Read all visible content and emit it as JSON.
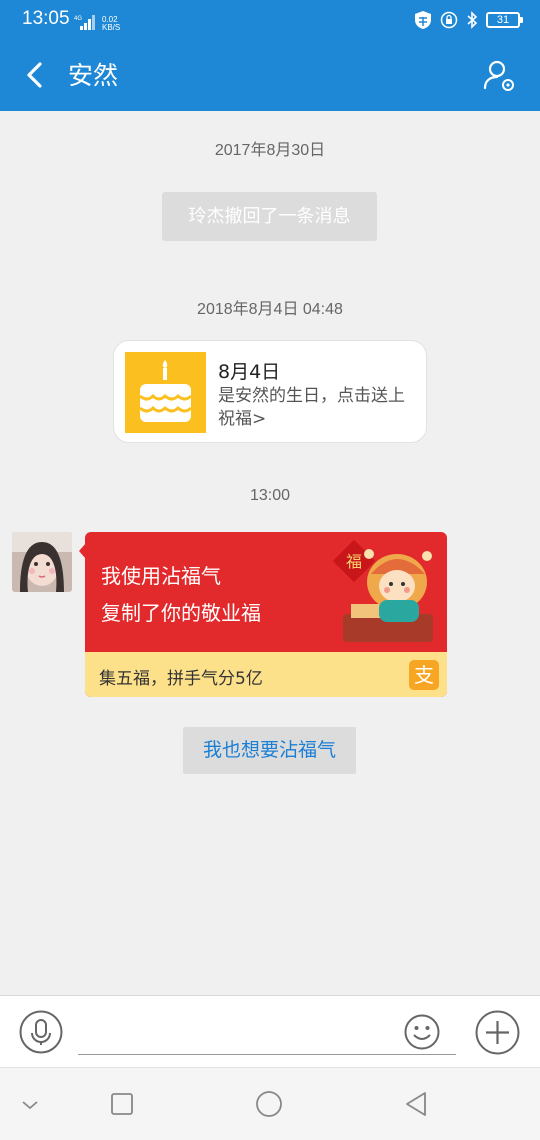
{
  "status_bar": {
    "time": "13:05",
    "network_label": "4G",
    "speed_value": "0.02",
    "speed_unit": "KB/S",
    "battery": "31"
  },
  "header": {
    "title": "安然",
    "back_icon": "chevron-left-icon",
    "profile_icon": "person-settings-icon"
  },
  "chat": {
    "timestamp_1": "2017年8月30日",
    "system_message": "玲杰撤回了一条消息",
    "timestamp_2": "2018年8月4日 04:48",
    "birthday_card": {
      "title": "8月4日",
      "description": "是安然的生日，点击送上祝福>"
    },
    "timestamp_3": "13:00",
    "fortune_card": {
      "line1": "我使用沾福气",
      "line2": "复制了你的敬业福",
      "footer": "集五福，拼手气分5亿",
      "brand_glyph": "支",
      "fu_char": "福"
    },
    "action_button": "我也想要沾福气"
  },
  "input_bar": {
    "mic_icon": "microphone-icon",
    "emoji_icon": "smiley-icon",
    "plus_icon": "plus-icon"
  },
  "colors": {
    "header_blue": "#1e88d6",
    "card_red": "#e2292b",
    "card_footer_yellow": "#fde08a",
    "cake_yellow": "#fbbf20",
    "link_blue": "#1b7fd6"
  }
}
